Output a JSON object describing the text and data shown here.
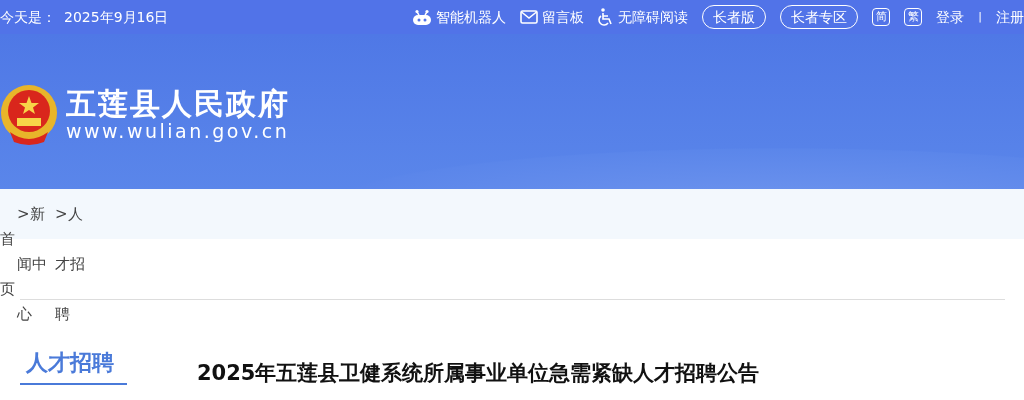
{
  "top_bar": {
    "date_label": "今天是：",
    "date": "2025年9月16日",
    "links": [
      {
        "kind": "robot",
        "label": "智能机器人"
      },
      {
        "kind": "mail",
        "label": "留言板"
      },
      {
        "kind": "accessibility",
        "label": "无障碍阅读"
      },
      {
        "kind": "pill",
        "label": "长者版"
      },
      {
        "kind": "pill",
        "label": "长者专区"
      },
      {
        "kind": "badge",
        "label": "简"
      },
      {
        "kind": "badge",
        "label": "繁"
      },
      {
        "kind": "text",
        "label": "登录"
      },
      {
        "kind": "separator",
        "label": "|"
      },
      {
        "kind": "text",
        "label": "注册"
      }
    ]
  },
  "header": {
    "site_name": "五莲县人民政府",
    "url": "www.wulian.gov.cn"
  },
  "breadcrumb": [
    "首页",
    ">新闻中心",
    ">人才招聘"
  ],
  "section_title": "人才招聘",
  "article_title": "2025年五莲县卫健系统所属事业单位急需紧缺人才招聘公告"
}
